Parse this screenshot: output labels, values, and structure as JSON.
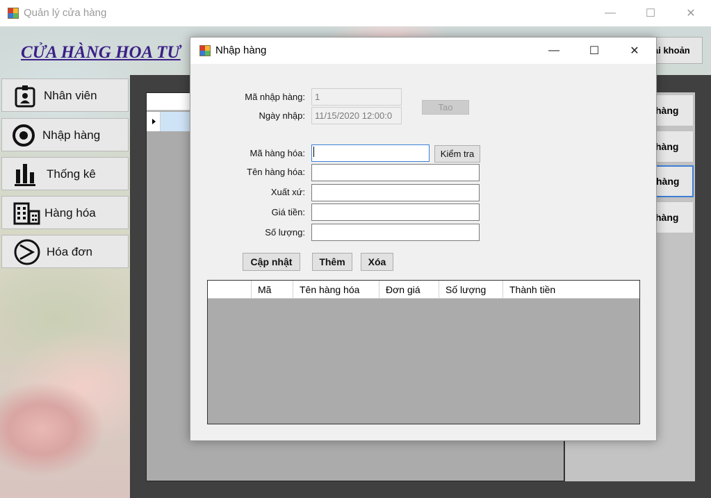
{
  "main_window": {
    "title": "Quản lý cửa hàng",
    "icon": "app-window-icon",
    "controls": {
      "minimize": "—",
      "maximize": "☐",
      "close": "✕"
    }
  },
  "shop_title": "CỬA HÀNG HOA TƯ",
  "sidebar": {
    "items": [
      {
        "label": "Nhân viên",
        "icon": "employee-badge-icon"
      },
      {
        "label": "Nhập hàng",
        "icon": "target-circle-icon"
      },
      {
        "label": "Thống kê",
        "icon": "bar-chart-icon"
      },
      {
        "label": "Hàng hóa",
        "icon": "building-icon"
      },
      {
        "label": "Hóa đơn",
        "icon": "play-circle-icon"
      }
    ]
  },
  "account_button": "ài khoản",
  "right_buttons": [
    "hàng",
    "hàng",
    "hàng",
    "hàng"
  ],
  "dialog": {
    "title": "Nhập hàng",
    "controls": {
      "minimize": "—",
      "maximize": "☐",
      "close": "✕"
    },
    "labels": {
      "ma_nhap_hang": "Mã nhập hàng:",
      "ngay_nhap": "Ngày nhập:",
      "ma_hang_hoa": "Mã hàng hóa:",
      "ten_hang_hoa": "Tên hàng hóa:",
      "xuat_xu": "Xuất xứ:",
      "gia_tien": "Giá tiền:",
      "so_luong": "Số lượng:"
    },
    "values": {
      "ma_nhap_hang": "1",
      "ngay_nhap": "11/15/2020 12:00:0",
      "ma_hang_hoa": "",
      "ten_hang_hoa": "",
      "xuat_xu": "",
      "gia_tien": "",
      "so_luong": ""
    },
    "buttons": {
      "tao": "Tao",
      "kiem_tra": "Kiểm tra",
      "cap_nhat": "Cập nhật",
      "them": "Thêm",
      "xoa": "Xóa"
    },
    "table": {
      "columns": [
        "Mã",
        "Tên hàng hóa",
        "Đơn giá",
        "Số lượng",
        "Thành tiền"
      ],
      "rows": []
    }
  },
  "colors": {
    "shop_title": "#3a1f86",
    "focus_border": "#3c7fd6",
    "grid_selected_row": "#cfe3f7",
    "dark_panel": "#404040",
    "grid_background": "#ababab"
  }
}
